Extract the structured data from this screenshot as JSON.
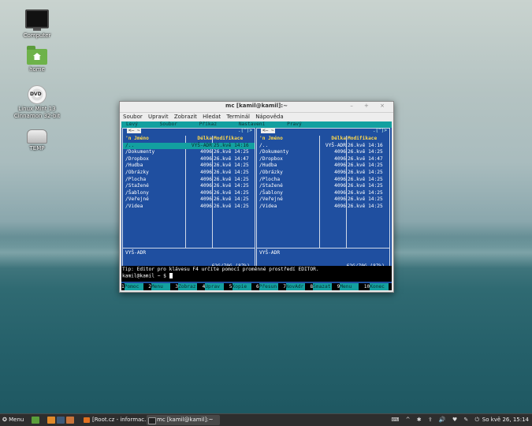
{
  "desktop": {
    "icons": [
      {
        "label": "Computer",
        "icon": "computer-icon"
      },
      {
        "label": "home",
        "icon": "home-folder-icon"
      },
      {
        "label": "Linux Mint 13",
        "label2": "Cinnamon 32-bit",
        "icon": "dvd-icon"
      },
      {
        "label": "TEMP",
        "icon": "drive-icon"
      }
    ]
  },
  "window": {
    "title": "mc [kamil@kamil]:~",
    "controls": "– + ×",
    "menu": [
      "Soubor",
      "Upravit",
      "Zobrazit",
      "Hledat",
      "Terminál",
      "Nápověda"
    ]
  },
  "mc": {
    "topmenu": [
      "Levý",
      "Soubor",
      "Příkaz",
      "Nastavení",
      "Pravý"
    ],
    "panel_top_left": "<—  ~",
    "panel_top_right": ".[^]>",
    "headers": {
      "name": "'n   Jméno",
      "size": "Délka",
      "mod": "Modifikace"
    },
    "left_rows": [
      {
        "name": "/..",
        "size": "VYŠ-ADR",
        "mod": "25.kvě 14:16"
      },
      {
        "name": "/Dokumenty",
        "size": "4096",
        "mod": "26.kvě 14:25"
      },
      {
        "name": "/Dropbox",
        "size": "4096",
        "mod": "26.kvě 14:47"
      },
      {
        "name": "/Hudba",
        "size": "4096",
        "mod": "26.kvě 14:25"
      },
      {
        "name": "/Obrázky",
        "size": "4096",
        "mod": "26.kvě 14:25"
      },
      {
        "name": "/Plocha",
        "size": "4096",
        "mod": "26.kvě 14:25"
      },
      {
        "name": "/Stažené",
        "size": "4096",
        "mod": "26.kvě 14:25"
      },
      {
        "name": "/Šablony",
        "size": "4096",
        "mod": "26.kvě 14:25"
      },
      {
        "name": "/Veřejné",
        "size": "4096",
        "mod": "26.kvě 14:25"
      },
      {
        "name": "/Videa",
        "size": "4096",
        "mod": "26.kvě 14:25"
      }
    ],
    "right_rows": [
      {
        "name": "/..",
        "size": "VYŠ-ADR",
        "mod": "26.kvě 14:16"
      },
      {
        "name": "/Dokumenty",
        "size": "4096",
        "mod": "26.kvě 14:25"
      },
      {
        "name": "/Dropbox",
        "size": "4096",
        "mod": "26.kvě 14:47"
      },
      {
        "name": "/Hudba",
        "size": "4096",
        "mod": "26.kvě 14:25"
      },
      {
        "name": "/Obrázky",
        "size": "4096",
        "mod": "26.kvě 14:25"
      },
      {
        "name": "/Plocha",
        "size": "4096",
        "mod": "26.kvě 14:25"
      },
      {
        "name": "/Stažené",
        "size": "4096",
        "mod": "26.kvě 14:25"
      },
      {
        "name": "/Šablony",
        "size": "4096",
        "mod": "26.kvě 14:25"
      },
      {
        "name": "/Veřejné",
        "size": "4096",
        "mod": "26.kvě 14:25"
      },
      {
        "name": "/Videa",
        "size": "4096",
        "mod": "26.kvě 14:25"
      }
    ],
    "panel_footer": "VYŠ-ADR",
    "disk_info": "62G/70G (87%)",
    "tip": "Tip: Editor pro klávesu F4 určíte pomocí proměnné prostředí EDITOR.",
    "prompt": "kamil@kamil ~ $ ",
    "fkeys": [
      {
        "n": "1",
        "t": "Pomoc"
      },
      {
        "n": "2",
        "t": "Menu"
      },
      {
        "n": "3",
        "t": "Zobraz"
      },
      {
        "n": "4",
        "t": "Uprav"
      },
      {
        "n": "5",
        "t": "Kopie"
      },
      {
        "n": "6",
        "t": "Přesun"
      },
      {
        "n": "7",
        "t": "NovAdr"
      },
      {
        "n": "8",
        "t": "Smazat"
      },
      {
        "n": "9",
        "t": "Menu"
      },
      {
        "n": "10",
        "t": "Konec"
      }
    ]
  },
  "taskbar": {
    "menu_label": "Menu",
    "tasks": [
      "[Root.cz - informac...",
      "mc [kamil@kamil]:~"
    ],
    "tray": "⌨ ^ ✱ ⇪ 🔊 ♥ ✎ ⏻",
    "clock": "So kvě 26, 15:14"
  }
}
